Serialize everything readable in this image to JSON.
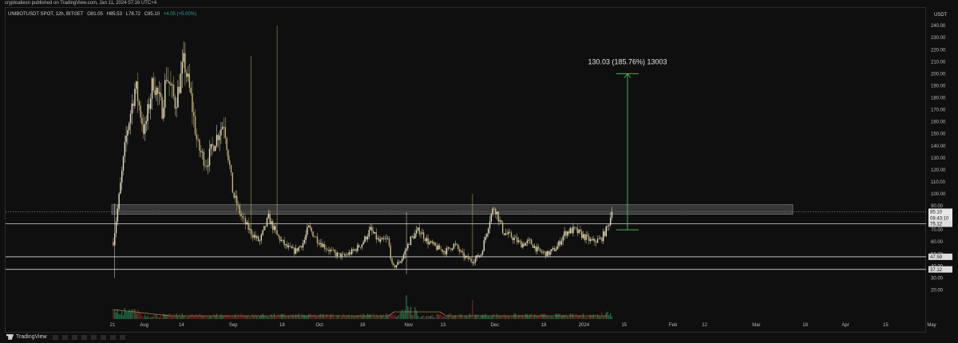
{
  "header": {
    "published": "cryptoaliesn published on TradingView.com, Jan 11, 2024 07:16 UTC+4"
  },
  "symbol": {
    "name": "UNIBOTUSDT SPOT, 12h, BITGET",
    "open": "O81.05",
    "high": "H85.53",
    "low": "L78.72",
    "close": "C85.10",
    "change": "+4.05 (+5.00%)",
    "change_color": "#26a69a"
  },
  "currency": "USDT",
  "colors": {
    "background": "#0f0f0f",
    "candle_up": "#ece7c8",
    "candle_down": "#c9b87a",
    "volume_up": "#1f6b45",
    "volume_down": "#6e1f1f",
    "zone": "#5a5a5a",
    "measure": "#4caf50",
    "price_tag": "#cfd8dc"
  },
  "chart_data": {
    "type": "candlestick",
    "x_ticks": [
      "21",
      "Aug",
      "14",
      "Sep",
      "18",
      "Oct",
      "16",
      "Nov",
      "13",
      "Dec",
      "18",
      "2024",
      "15",
      "Feb",
      "12",
      "Mar",
      "18",
      "Apr",
      "15",
      "May"
    ],
    "y_ticks": [
      "20.00",
      "30.00",
      "40.00",
      "50.00",
      "60.00",
      "70.00",
      "80.00",
      "90.00",
      "100.00",
      "110.00",
      "120.00",
      "130.00",
      "140.00",
      "150.00",
      "160.00",
      "170.00",
      "180.00",
      "190.00",
      "200.00",
      "210.00",
      "220.00",
      "230.00",
      "240.00"
    ],
    "ylim": [
      0,
      250
    ],
    "horizontal_lines": [
      75.12,
      47.59,
      37.12
    ],
    "resistance_zone": [
      83,
      91
    ],
    "price_labels": [
      {
        "value": 85.1,
        "text": "85.10"
      },
      {
        "value": 80.0,
        "text": "08:43:10"
      },
      {
        "value": 75.12,
        "text": "75.12"
      },
      {
        "value": 47.59,
        "text": "47.59"
      },
      {
        "value": 37.12,
        "text": "37.12"
      }
    ],
    "measure": {
      "from": 70,
      "to": 200,
      "label": "130.03 (185.76%) 13003"
    },
    "key_points": [
      {
        "date": "2023-07-21",
        "low": 30,
        "high": 90
      },
      {
        "date": "2023-08-14",
        "high": 240
      },
      {
        "date": "2023-09-08",
        "high": 165
      },
      {
        "date": "2023-11-01",
        "low": 33,
        "high": 85
      },
      {
        "date": "2023-12-01",
        "high": 100
      },
      {
        "date": "2024-01-11",
        "close": 85.1
      }
    ]
  },
  "footer": {
    "logo_text": "TradingView"
  }
}
